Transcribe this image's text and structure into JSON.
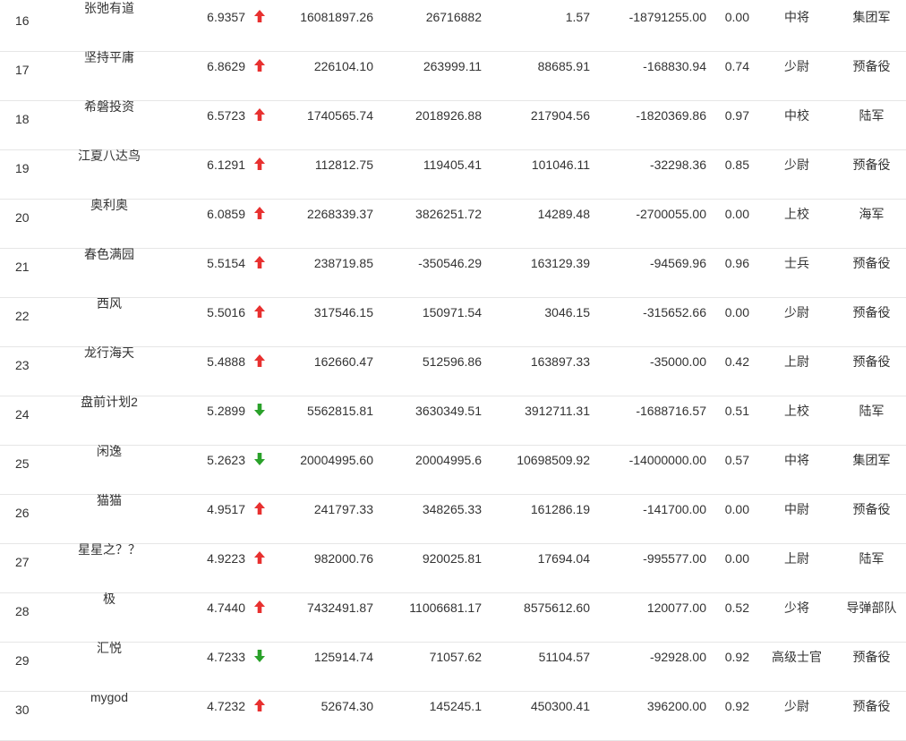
{
  "colors": {
    "up": "#e8302f",
    "down": "#2aa12a",
    "text": "#333333",
    "divider": "#e6e6e6"
  },
  "rows": [
    {
      "rank": "16",
      "name": "张弛有道",
      "score": "6.9357",
      "trend": "up",
      "c1": "16081897.26",
      "c2": "26716882",
      "c3": "1.57",
      "c4": "-18791255.00",
      "c5": "0.00",
      "rank_title": "中将",
      "army": "集团军"
    },
    {
      "rank": "17",
      "name": "坚持平庸",
      "score": "6.8629",
      "trend": "up",
      "c1": "226104.10",
      "c2": "263999.11",
      "c3": "88685.91",
      "c4": "-168830.94",
      "c5": "0.74",
      "rank_title": "少尉",
      "army": "预备役"
    },
    {
      "rank": "18",
      "name": "希磐投资",
      "score": "6.5723",
      "trend": "up",
      "c1": "1740565.74",
      "c2": "2018926.88",
      "c3": "217904.56",
      "c4": "-1820369.86",
      "c5": "0.97",
      "rank_title": "中校",
      "army": "陆军"
    },
    {
      "rank": "19",
      "name": "江夏八达鸟",
      "score": "6.1291",
      "trend": "up",
      "c1": "112812.75",
      "c2": "119405.41",
      "c3": "101046.11",
      "c4": "-32298.36",
      "c5": "0.85",
      "rank_title": "少尉",
      "army": "预备役"
    },
    {
      "rank": "20",
      "name": "奥利奥",
      "score": "6.0859",
      "trend": "up",
      "c1": "2268339.37",
      "c2": "3826251.72",
      "c3": "14289.48",
      "c4": "-2700055.00",
      "c5": "0.00",
      "rank_title": "上校",
      "army": "海军"
    },
    {
      "rank": "21",
      "name": "春色满园",
      "score": "5.5154",
      "trend": "up",
      "c1": "238719.85",
      "c2": "-350546.29",
      "c3": "163129.39",
      "c4": "-94569.96",
      "c5": "0.96",
      "rank_title": "士兵",
      "army": "预备役"
    },
    {
      "rank": "22",
      "name": "西风",
      "score": "5.5016",
      "trend": "up",
      "c1": "317546.15",
      "c2": "150971.54",
      "c3": "3046.15",
      "c4": "-315652.66",
      "c5": "0.00",
      "rank_title": "少尉",
      "army": "预备役"
    },
    {
      "rank": "23",
      "name": "龙行海天",
      "score": "5.4888",
      "trend": "up",
      "c1": "162660.47",
      "c2": "512596.86",
      "c3": "163897.33",
      "c4": "-35000.00",
      "c5": "0.42",
      "rank_title": "上尉",
      "army": "预备役"
    },
    {
      "rank": "24",
      "name": "盘前计划2",
      "score": "5.2899",
      "trend": "down",
      "c1": "5562815.81",
      "c2": "3630349.51",
      "c3": "3912711.31",
      "c4": "-1688716.57",
      "c5": "0.51",
      "rank_title": "上校",
      "army": "陆军"
    },
    {
      "rank": "25",
      "name": "闲逸",
      "score": "5.2623",
      "trend": "down",
      "c1": "20004995.60",
      "c2": "20004995.6",
      "c3": "10698509.92",
      "c4": "-14000000.00",
      "c5": "0.57",
      "rank_title": "中将",
      "army": "集团军"
    },
    {
      "rank": "26",
      "name": "猫猫",
      "score": "4.9517",
      "trend": "up",
      "c1": "241797.33",
      "c2": "348265.33",
      "c3": "161286.19",
      "c4": "-141700.00",
      "c5": "0.00",
      "rank_title": "中尉",
      "army": "预备役"
    },
    {
      "rank": "27",
      "name": "星星之？？",
      "score": "4.9223",
      "trend": "up",
      "c1": "982000.76",
      "c2": "920025.81",
      "c3": "17694.04",
      "c4": "-995577.00",
      "c5": "0.00",
      "rank_title": "上尉",
      "army": "陆军"
    },
    {
      "rank": "28",
      "name": "极",
      "score": "4.7440",
      "trend": "up",
      "c1": "7432491.87",
      "c2": "11006681.17",
      "c3": "8575612.60",
      "c4": "120077.00",
      "c5": "0.52",
      "rank_title": "少将",
      "army": "导弹部队"
    },
    {
      "rank": "29",
      "name": "汇悦",
      "score": "4.7233",
      "trend": "down",
      "c1": "125914.74",
      "c2": "71057.62",
      "c3": "51104.57",
      "c4": "-92928.00",
      "c5": "0.92",
      "rank_title": "高级士官",
      "army": "预备役"
    },
    {
      "rank": "30",
      "name": "mygod",
      "score": "4.7232",
      "trend": "up",
      "c1": "52674.30",
      "c2": "145245.1",
      "c3": "450300.41",
      "c4": "396200.00",
      "c5": "0.92",
      "rank_title": "少尉",
      "army": "预备役"
    }
  ]
}
